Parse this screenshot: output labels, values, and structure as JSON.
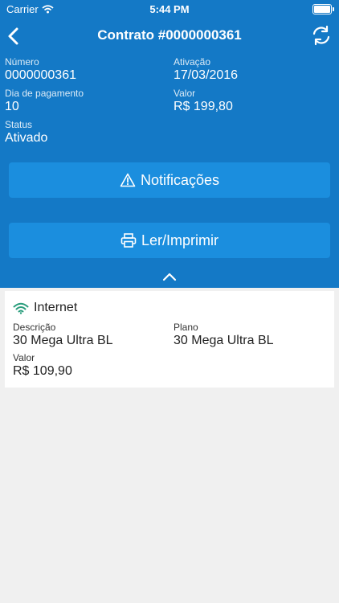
{
  "status_bar": {
    "carrier": "Carrier",
    "time": "5:44 PM"
  },
  "nav": {
    "title": "Contrato #0000000361",
    "back_icon": "chevron-left-icon",
    "refresh_icon": "refresh-icon"
  },
  "contract": {
    "numero_label": "Número",
    "numero": "0000000361",
    "ativacao_label": "Ativação",
    "ativacao": "17/03/2016",
    "dia_label": "Dia de pagamento",
    "dia": "10",
    "valor_label": "Valor",
    "valor": "R$ 199,80",
    "status_label": "Status",
    "status": "Ativado"
  },
  "buttons": {
    "notificacoes": "Notificações",
    "imprimir": "Ler/Imprimir"
  },
  "service": {
    "title": "Internet",
    "descricao_label": "Descrição",
    "descricao": "30 Mega Ultra BL",
    "plano_label": "Plano",
    "plano": "30 Mega Ultra BL",
    "valor_label": "Valor",
    "valor": "R$ 109,90"
  },
  "colors": {
    "header": "#1479c6",
    "button": "#1b8ede",
    "wifi": "#2a9d7c"
  }
}
